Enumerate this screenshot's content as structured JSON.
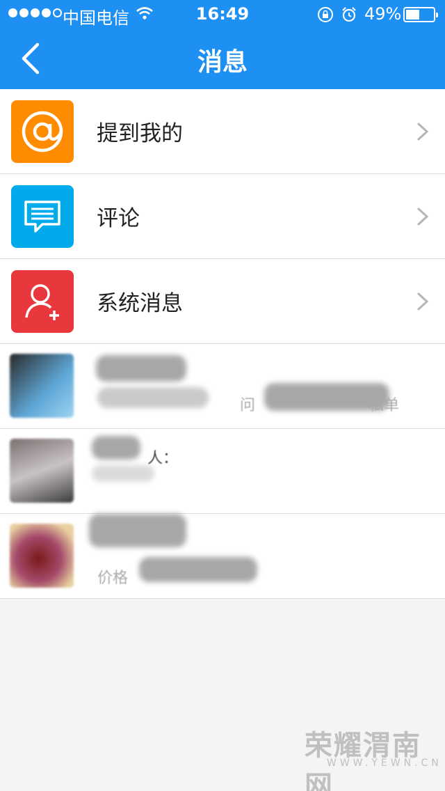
{
  "status_bar": {
    "carrier": "中国电信",
    "time": "16:49",
    "battery_percent": "49%",
    "battery_level": 0.49
  },
  "nav": {
    "title": "消息",
    "back_icon": "chevron-left-icon"
  },
  "colors": {
    "nav_bg": "#1e90f4",
    "mention_tile": "#ff8c00",
    "comment_tile": "#00aaeb",
    "system_tile": "#e8383d"
  },
  "menu_items": [
    {
      "label": "提到我的",
      "icon": "at-icon"
    },
    {
      "label": "评论",
      "icon": "comment-icon"
    },
    {
      "label": "系统消息",
      "icon": "add-user-icon"
    }
  ],
  "conversations": [
    {
      "preview_fragment": "问",
      "preview_fragment_2": "私单"
    },
    {
      "preview_fragment": "人："
    },
    {
      "preview_fragment": "价格"
    }
  ],
  "watermark": {
    "text": "荣耀渭南网",
    "sub": "WWW.YEWN.CN"
  }
}
